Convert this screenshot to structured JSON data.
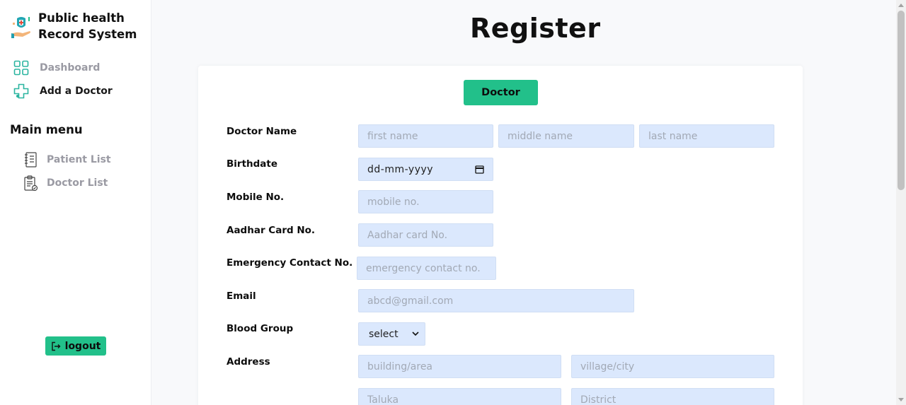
{
  "sidebar": {
    "brand_line1": "Public health",
    "brand_line2": "Record System",
    "dashboard": "Dashboard",
    "add_doctor": "Add a Doctor",
    "main_menu": "Main menu",
    "patient_list": "Patient List",
    "doctor_list": "Doctor List",
    "logout": "logout"
  },
  "page": {
    "title": "Register",
    "role_button": "Doctor"
  },
  "form": {
    "doctor_name_label": "Doctor Name",
    "first_name_placeholder": "first name",
    "middle_name_placeholder": "middle name",
    "last_name_placeholder": "last name",
    "birthdate_label": "Birthdate",
    "birthdate_value": "dd-mm-yyyy",
    "mobile_label": "Mobile No.",
    "mobile_placeholder": "mobile no.",
    "aadhar_label": "Aadhar Card No.",
    "aadhar_placeholder": "Aadhar card No.",
    "emergency_label": "Emergency Contact No.",
    "emergency_placeholder": "emergency contact no.",
    "email_label": "Email",
    "email_placeholder": "abcd@gmail.com",
    "blood_group_label": "Blood Group",
    "blood_group_value": "select",
    "address_label": "Address",
    "building_placeholder": "building/area",
    "village_placeholder": "village/city",
    "taluka_placeholder": "Taluka",
    "district_placeholder": "District"
  },
  "colors": {
    "accent": "#22c08a",
    "input_bg": "#dbe8fd"
  }
}
